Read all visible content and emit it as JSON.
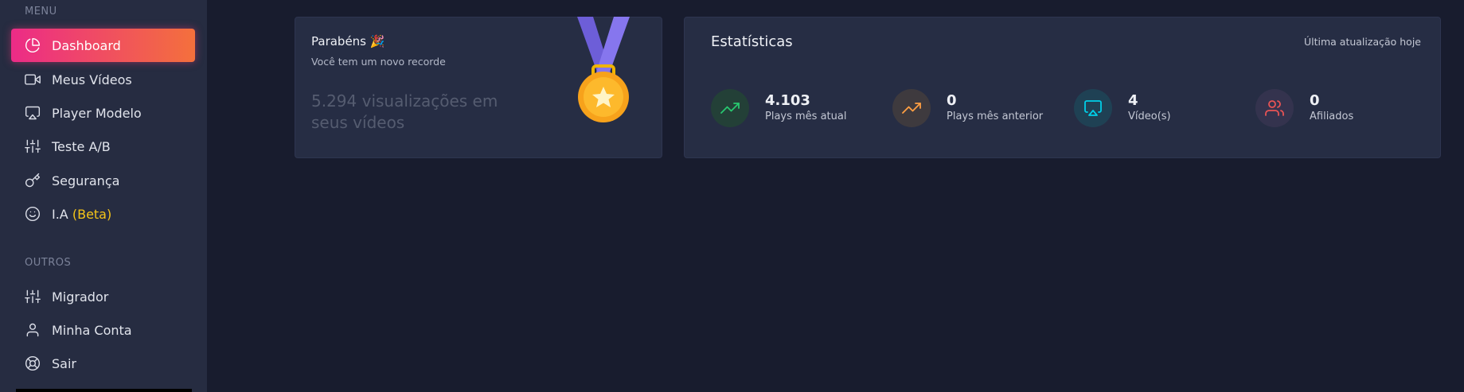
{
  "sidebar": {
    "menu_title": "MENU",
    "others_title": "OUTROS",
    "menu_items": [
      {
        "label": "Dashboard",
        "icon": "pie-chart-icon"
      },
      {
        "label": "Meus Vídeos",
        "icon": "video-camera-icon"
      },
      {
        "label": "Player Modelo",
        "icon": "airplay-icon"
      },
      {
        "label": "Teste A/B",
        "icon": "sliders-icon"
      },
      {
        "label": "Segurança",
        "icon": "key-icon"
      },
      {
        "label": "I.A",
        "badge": "(Beta)",
        "icon": "smile-icon"
      }
    ],
    "other_items": [
      {
        "label": "Migrador",
        "icon": "sliders-icon"
      },
      {
        "label": "Minha Conta",
        "icon": "user-icon"
      },
      {
        "label": "Sair",
        "icon": "life-buoy-icon"
      }
    ]
  },
  "congrats": {
    "title": "Parabéns 🎉",
    "subtitle": "Você tem um novo recorde",
    "record": "5.294 visualizações em seus vídeos"
  },
  "stats": {
    "title": "Estatísticas",
    "updated": "Última atualização hoje",
    "items": [
      {
        "value": "4.103",
        "label": "Plays mês atual",
        "icon": "trending-up-icon",
        "color": "#28c76f"
      },
      {
        "value": "0",
        "label": "Plays mês anterior",
        "icon": "trending-up-icon",
        "color": "#ff9f43"
      },
      {
        "value": "4",
        "label": "Vídeo(s)",
        "icon": "airplay-icon",
        "color": "#00cfe8"
      },
      {
        "value": "0",
        "label": "Afiliados",
        "icon": "users-icon",
        "color": "#ea5455"
      }
    ]
  },
  "colors": {
    "accent_gradient_start": "#ec2b87",
    "accent_gradient_end": "#f4703c",
    "beta": "#f5c518",
    "background": "#181c2e",
    "card": "#262d44"
  }
}
